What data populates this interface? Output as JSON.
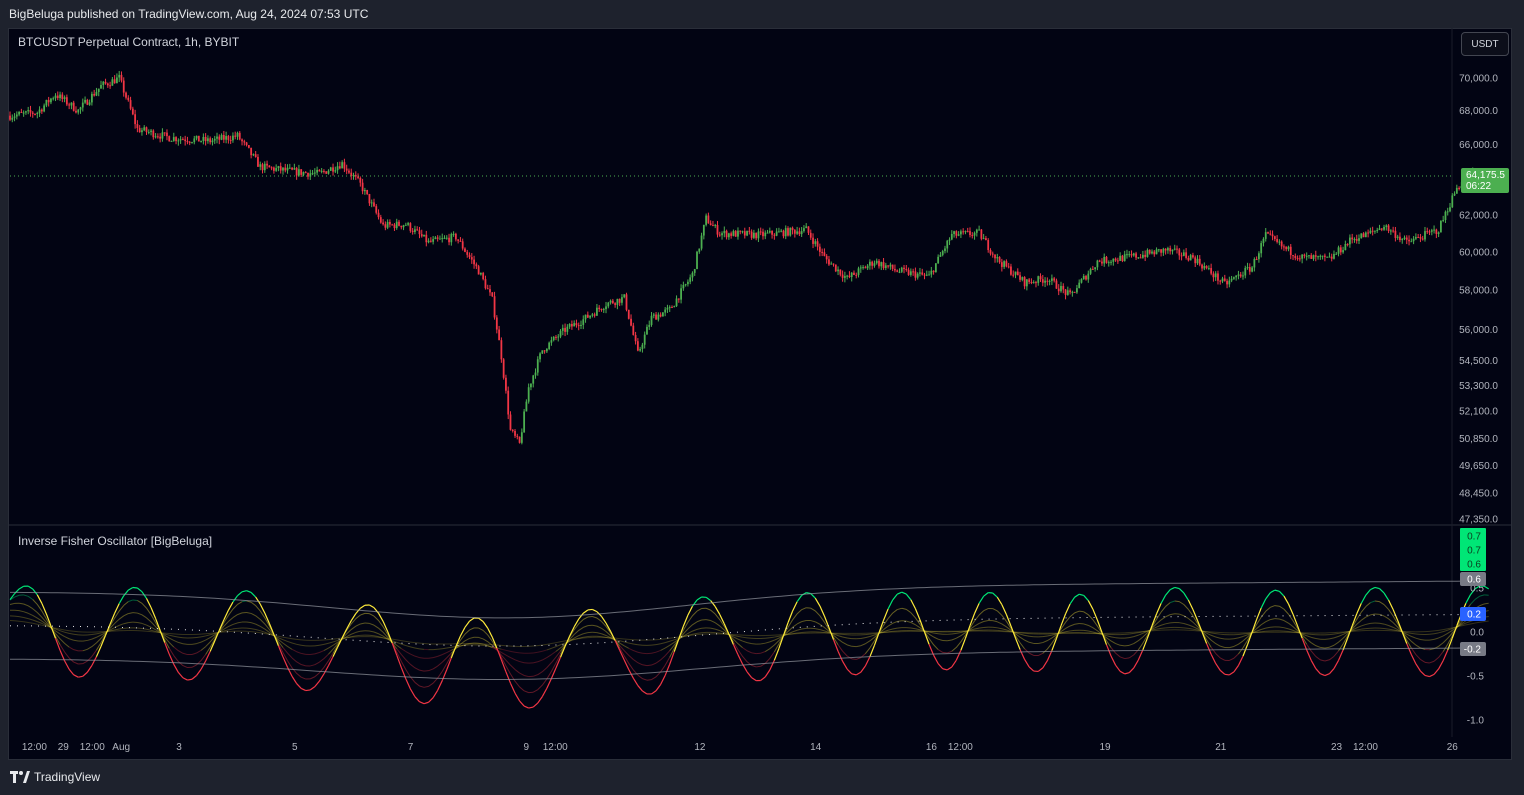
{
  "header": {
    "publish_text": "BigBeluga published on TradingView.com, Aug 24, 2024 07:53 UTC"
  },
  "symbol": {
    "title": "BTCUSDT Perpetual Contract, 1h, BYBIT"
  },
  "currency_button": {
    "label": "USDT"
  },
  "indicator": {
    "title": "Inverse Fisher Oscillator [BigBeluga]"
  },
  "footer": {
    "logo_text": "TradingView"
  },
  "price_axis": {
    "ticks": [
      "70,000.0",
      "68,000.0",
      "66,000.0",
      "62,000.0",
      "60,000.0",
      "58,000.0",
      "56,000.0",
      "54,500.0",
      "53,300.0",
      "52,100.0",
      "50,850.0",
      "49,650.0",
      "48,450.0",
      "47,350.0"
    ],
    "tick_values": [
      70000,
      68000,
      66000,
      62000,
      60000,
      58000,
      56000,
      54500,
      53300,
      52100,
      50850,
      49650,
      48450,
      47350
    ],
    "last_price": "64,175.5",
    "last_price_value": 64175.5,
    "countdown": "06:22"
  },
  "osc_axis": {
    "ticks": [
      "0.5",
      "0.0",
      "-0.5",
      "-1.0"
    ],
    "tick_values": [
      0.5,
      0.0,
      -0.5,
      -1.0
    ],
    "badges": [
      {
        "text": "0.7",
        "value": 0.7,
        "color": "#00e676"
      },
      {
        "text": "0.7",
        "value": 0.7,
        "color": "#00e676"
      },
      {
        "text": "0.6",
        "value": 0.6,
        "color": "#00e676"
      },
      {
        "text": "0.6",
        "value": 0.6,
        "color": "#787b86"
      },
      {
        "text": "0.2",
        "value": 0.2,
        "color": "#2962ff"
      },
      {
        "text": "-0.2",
        "value": -0.2,
        "color": "#787b86"
      }
    ]
  },
  "time_axis": {
    "labels": [
      "12:00",
      "29",
      "12:00",
      "Aug",
      "3",
      "5",
      "7",
      "9",
      "12:00",
      "12",
      "14",
      "16",
      "12:00",
      "19",
      "21",
      "23",
      "12:00",
      "26"
    ],
    "positions_hours": [
      12,
      24,
      36,
      48,
      72,
      120,
      168,
      216,
      228,
      288,
      336,
      384,
      396,
      456,
      504,
      552,
      564,
      600
    ]
  },
  "colors": {
    "up": "#4caf50",
    "down": "#f23645",
    "bg": "#020413",
    "osc_green": "#00e676",
    "osc_yellow": "#ffeb3b",
    "osc_red": "#f23645",
    "band": "#9598a1"
  },
  "chart_data": [
    {
      "type": "candlestick",
      "title": "BTCUSDT Perpetual Contract, 1h, BYBIT",
      "ylim": [
        47350,
        70000
      ],
      "x_range_hours": [
        0,
        633
      ],
      "candle_count": 558,
      "close_anchors": [
        {
          "h": 0,
          "v": 67700
        },
        {
          "h": 12,
          "v": 67900
        },
        {
          "h": 20,
          "v": 69000
        },
        {
          "h": 30,
          "v": 68000
        },
        {
          "h": 40,
          "v": 69500
        },
        {
          "h": 48,
          "v": 70000
        },
        {
          "h": 56,
          "v": 66900
        },
        {
          "h": 70,
          "v": 66400
        },
        {
          "h": 88,
          "v": 66200
        },
        {
          "h": 100,
          "v": 66500
        },
        {
          "h": 110,
          "v": 64700
        },
        {
          "h": 126,
          "v": 64400
        },
        {
          "h": 136,
          "v": 64300
        },
        {
          "h": 146,
          "v": 64900
        },
        {
          "h": 154,
          "v": 63700
        },
        {
          "h": 164,
          "v": 61400
        },
        {
          "h": 174,
          "v": 61500
        },
        {
          "h": 184,
          "v": 60500
        },
        {
          "h": 196,
          "v": 60800
        },
        {
          "h": 206,
          "v": 59000
        },
        {
          "h": 212,
          "v": 57500
        },
        {
          "h": 216,
          "v": 54700
        },
        {
          "h": 220,
          "v": 51200
        },
        {
          "h": 224,
          "v": 50600
        },
        {
          "h": 228,
          "v": 53200
        },
        {
          "h": 234,
          "v": 55000
        },
        {
          "h": 244,
          "v": 56000
        },
        {
          "h": 252,
          "v": 56500
        },
        {
          "h": 262,
          "v": 57300
        },
        {
          "h": 270,
          "v": 57600
        },
        {
          "h": 276,
          "v": 54800
        },
        {
          "h": 282,
          "v": 56600
        },
        {
          "h": 290,
          "v": 57000
        },
        {
          "h": 300,
          "v": 58800
        },
        {
          "h": 306,
          "v": 61800
        },
        {
          "h": 312,
          "v": 61000
        },
        {
          "h": 330,
          "v": 60900
        },
        {
          "h": 350,
          "v": 61200
        },
        {
          "h": 358,
          "v": 59700
        },
        {
          "h": 368,
          "v": 58600
        },
        {
          "h": 380,
          "v": 59500
        },
        {
          "h": 390,
          "v": 59000
        },
        {
          "h": 404,
          "v": 58700
        },
        {
          "h": 414,
          "v": 60900
        },
        {
          "h": 426,
          "v": 61000
        },
        {
          "h": 434,
          "v": 59600
        },
        {
          "h": 446,
          "v": 58400
        },
        {
          "h": 456,
          "v": 58600
        },
        {
          "h": 466,
          "v": 57700
        },
        {
          "h": 478,
          "v": 59500
        },
        {
          "h": 496,
          "v": 59800
        },
        {
          "h": 508,
          "v": 60100
        },
        {
          "h": 520,
          "v": 59700
        },
        {
          "h": 534,
          "v": 58300
        },
        {
          "h": 546,
          "v": 59200
        },
        {
          "h": 552,
          "v": 60900
        },
        {
          "h": 560,
          "v": 60200
        },
        {
          "h": 568,
          "v": 59700
        },
        {
          "h": 580,
          "v": 59600
        },
        {
          "h": 590,
          "v": 60700
        },
        {
          "h": 596,
          "v": 60900
        },
        {
          "h": 604,
          "v": 61400
        },
        {
          "h": 614,
          "v": 60500
        },
        {
          "h": 628,
          "v": 61200
        },
        {
          "h": 636,
          "v": 63500
        },
        {
          "h": 642,
          "v": 64300
        },
        {
          "h": 650,
          "v": 64175.5
        }
      ]
    },
    {
      "type": "line",
      "title": "Inverse Fisher Oscillator [BigBeluga]",
      "ylim": [
        -1.0,
        0.5
      ],
      "series": [
        {
          "name": "",
          "values": [
            0.7,
            0.7,
            0.6
          ]
        },
        {
          "name": "",
          "values": [
            0.6,
            0.2,
            -0.2
          ]
        }
      ]
    }
  ]
}
